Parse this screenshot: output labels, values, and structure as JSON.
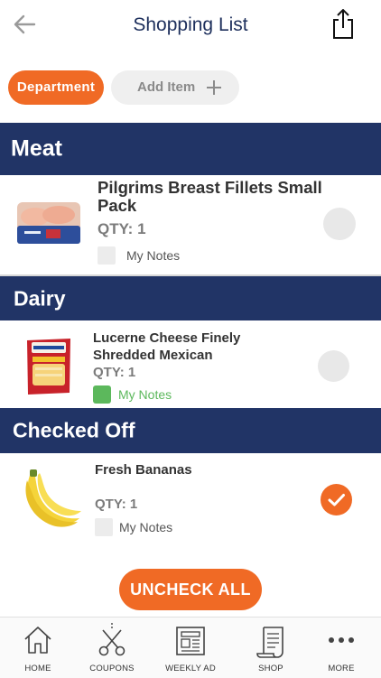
{
  "header": {
    "title": "Shopping List",
    "back_icon": "back-arrow-icon",
    "share_icon": "share-icon"
  },
  "filters": {
    "department_label": "Department",
    "add_item_label": "Add Item"
  },
  "sections": [
    {
      "title": "Meat",
      "items": [
        {
          "name": "Pilgrims Breast Fillets Small Pack",
          "qty": "QTY: 1",
          "notes": "My Notes",
          "notes_checked": false,
          "checked": false
        }
      ]
    },
    {
      "title": "Dairy",
      "items": [
        {
          "name": "Lucerne Cheese Finely Shredded Mexican",
          "qty": "QTY: 1",
          "notes": "My Notes",
          "notes_checked": true,
          "checked": false
        }
      ]
    },
    {
      "title": "Checked Off",
      "items": [
        {
          "name": "Fresh Bananas",
          "qty": "QTY: 1",
          "notes": "My Notes",
          "notes_checked": false,
          "checked": true
        }
      ]
    }
  ],
  "uncheck_all_label": "UNCHECK ALL",
  "tabs": [
    {
      "label": "HOME",
      "icon": "home-icon"
    },
    {
      "label": "COUPONS",
      "icon": "scissors-icon"
    },
    {
      "label": "WEEKLY AD",
      "icon": "newspaper-icon"
    },
    {
      "label": "SHOP",
      "icon": "receipt-icon"
    },
    {
      "label": "MORE",
      "icon": "more-dots-icon"
    }
  ],
  "colors": {
    "accent": "#f06a25",
    "navy": "#213466",
    "title": "#1d2f5c",
    "notes_green": "#5cb85c"
  }
}
